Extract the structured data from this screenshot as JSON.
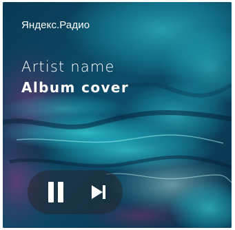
{
  "brand": {
    "name": "Яндекс.Радио"
  },
  "track": {
    "artist": "Artist name",
    "album": "Album cover"
  },
  "controls": {
    "pause_icon": "pause-icon",
    "next_icon": "skip-next-icon"
  },
  "colors": {
    "text": "#ffffff",
    "controls_bg": "rgba(38,38,46,0.55)",
    "artwork_base": "#0b3550",
    "artwork_cyan": "#27d0d6",
    "artwork_magenta": "#9a2a78"
  }
}
